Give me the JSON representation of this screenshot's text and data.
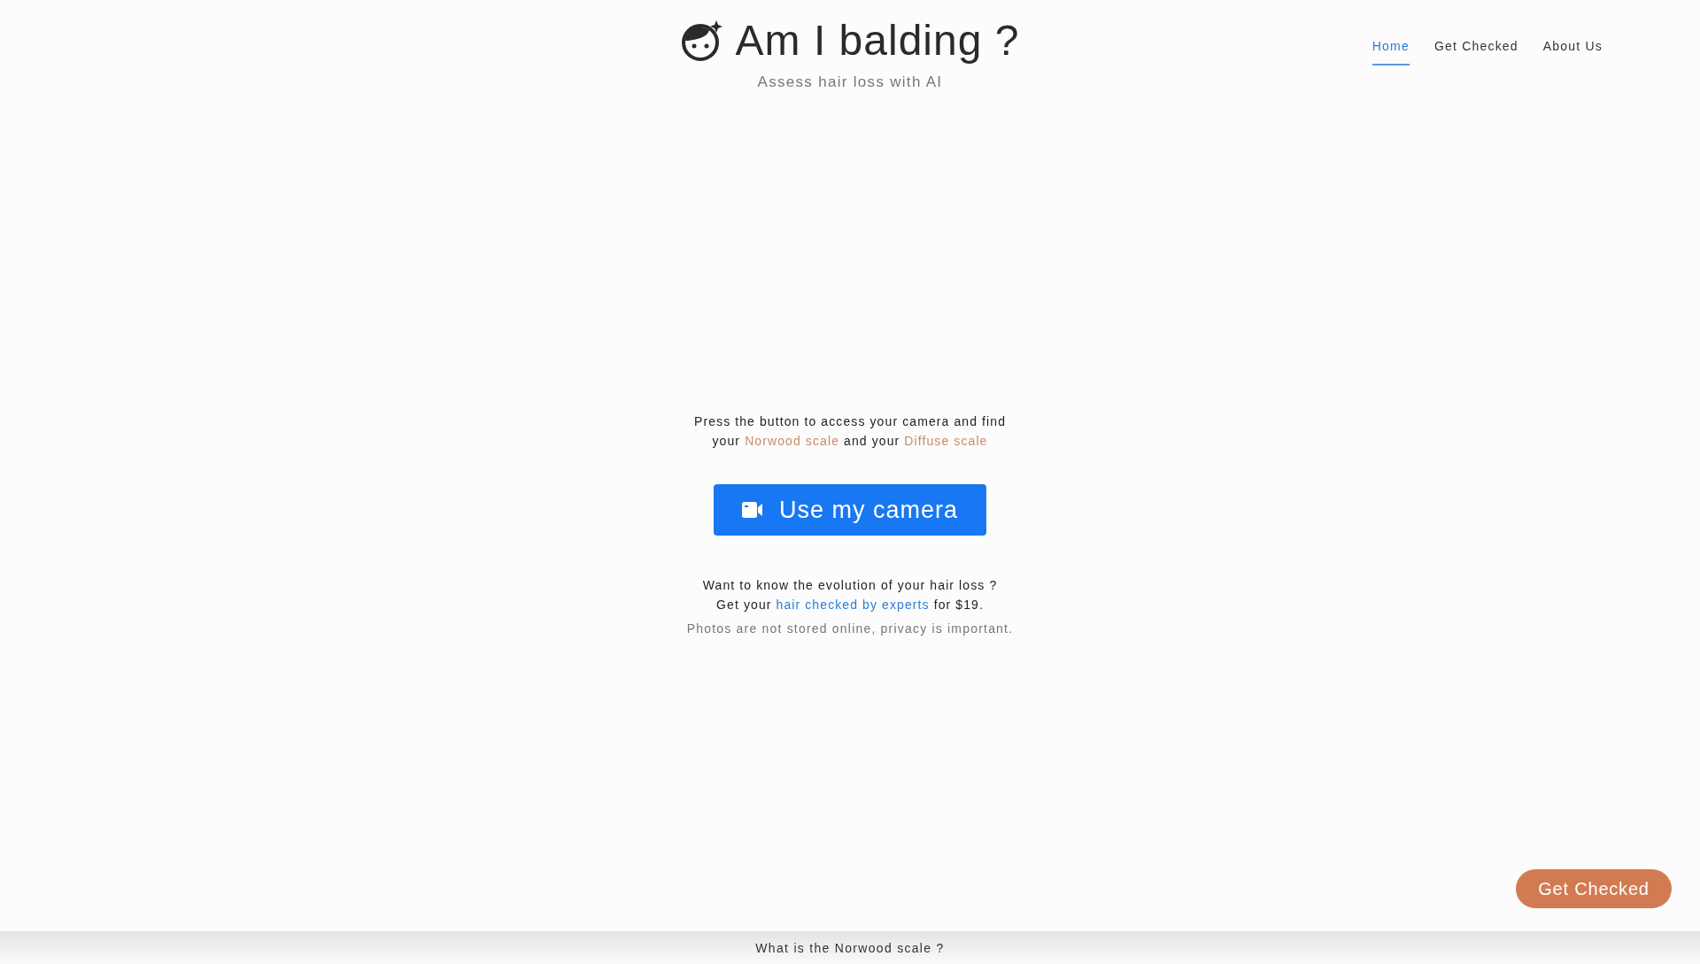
{
  "header": {
    "title": "Am I balding ?",
    "subtitle": "Assess hair loss with AI"
  },
  "nav": [
    {
      "label": "Home",
      "selected": true
    },
    {
      "label": "Get Checked",
      "selected": false
    },
    {
      "label": "About Us",
      "selected": false
    }
  ],
  "intro": {
    "lines": [
      [
        {
          "kind": "text",
          "text": "Press the button to access your camera and find"
        }
      ],
      [
        {
          "kind": "text",
          "text": "your "
        },
        {
          "kind": "link",
          "text": "Norwood scale"
        },
        {
          "kind": "text",
          "text": " and your "
        },
        {
          "kind": "link",
          "text": "Diffuse scale"
        }
      ]
    ]
  },
  "camera_button": {
    "label": "Use my camera"
  },
  "offer": {
    "lines": [
      [
        {
          "kind": "text",
          "text": "Want to know the evolution of your hair loss ?"
        }
      ],
      [
        {
          "kind": "text",
          "text": "Get your "
        },
        {
          "kind": "offer-link",
          "text": "hair checked by experts"
        },
        {
          "kind": "text",
          "text": " for $19."
        }
      ]
    ]
  },
  "privacy_note": "Photos are not stored online, privacy is important.",
  "floating_button": {
    "label": "Get Checked"
  },
  "bottom_bar": {
    "label": "What is the Norwood scale ?"
  }
}
